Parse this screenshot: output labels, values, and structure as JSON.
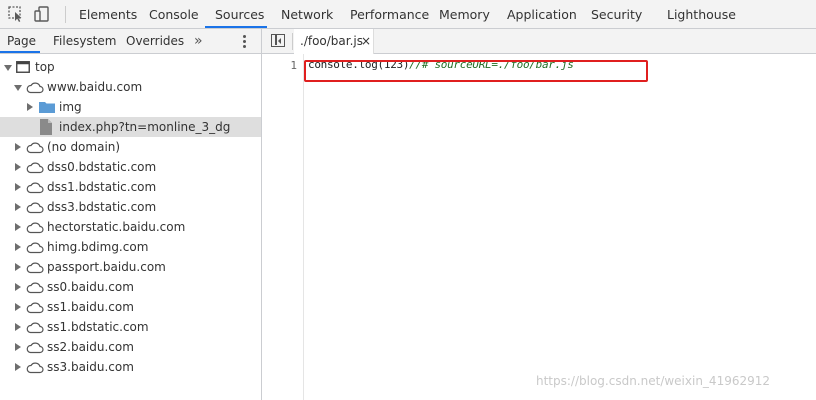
{
  "toolbar": {
    "inspect_icon": "element-picker-icon",
    "device_icon": "device-toolbar-icon",
    "tabs": [
      {
        "label": "Elements"
      },
      {
        "label": "Console"
      },
      {
        "label": "Sources"
      },
      {
        "label": "Network"
      },
      {
        "label": "Performance"
      },
      {
        "label": "Memory"
      },
      {
        "label": "Application"
      },
      {
        "label": "Security"
      },
      {
        "label": "Lighthouse"
      }
    ],
    "active_tab": "Sources",
    "accent_color": "#1a73e8"
  },
  "navigator": {
    "tabs": [
      {
        "label": "Page"
      },
      {
        "label": "Filesystem"
      },
      {
        "label": "Overrides"
      }
    ],
    "more_tabs_label": "»",
    "active_tab": "Page",
    "tree": [
      {
        "label": "top",
        "icon": "frame-icon",
        "expanded": true
      },
      {
        "label": "www.baidu.com",
        "icon": "cloud-icon",
        "expanded": true
      },
      {
        "label": "img",
        "icon": "folder-icon",
        "expanded": false
      },
      {
        "label": "index.php?tn=monline_3_dg",
        "icon": "file-icon",
        "selected": true
      },
      {
        "label": "(no domain)",
        "icon": "cloud-icon",
        "expanded": false
      },
      {
        "label": "dss0.bdstatic.com",
        "icon": "cloud-icon",
        "expanded": false
      },
      {
        "label": "dss1.bdstatic.com",
        "icon": "cloud-icon",
        "expanded": false
      },
      {
        "label": "dss3.bdstatic.com",
        "icon": "cloud-icon",
        "expanded": false
      },
      {
        "label": "hectorstatic.baidu.com",
        "icon": "cloud-icon",
        "expanded": false
      },
      {
        "label": "himg.bdimg.com",
        "icon": "cloud-icon",
        "expanded": false
      },
      {
        "label": "passport.baidu.com",
        "icon": "cloud-icon",
        "expanded": false
      },
      {
        "label": "ss0.baidu.com",
        "icon": "cloud-icon",
        "expanded": false
      },
      {
        "label": "ss1.baidu.com",
        "icon": "cloud-icon",
        "expanded": false
      },
      {
        "label": "ss1.bdstatic.com",
        "icon": "cloud-icon",
        "expanded": false
      },
      {
        "label": "ss2.baidu.com",
        "icon": "cloud-icon",
        "expanded": false
      },
      {
        "label": "ss3.baidu.com",
        "icon": "cloud-icon",
        "expanded": false
      }
    ]
  },
  "editor": {
    "file_tab": {
      "label": "./foo/bar.js",
      "close_label": "×"
    },
    "lines": [
      {
        "number": "1",
        "code": "console.log(123)",
        "comment": "//# sourceURL=./foo/bar.js"
      }
    ],
    "highlight_color": "#e01f1f"
  },
  "watermark": "https://blog.csdn.net/weixin_41962912"
}
